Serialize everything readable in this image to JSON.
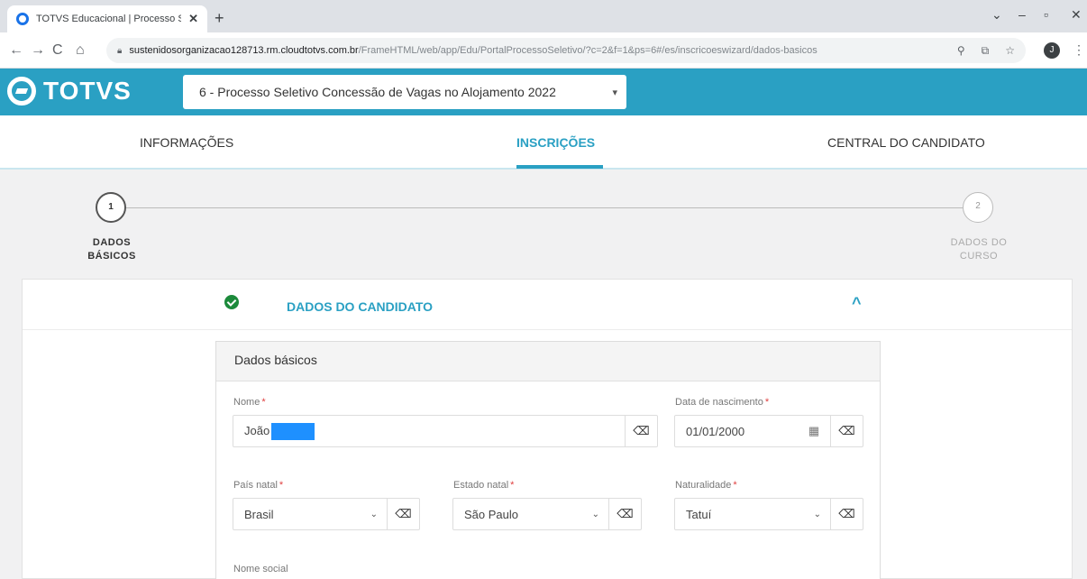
{
  "browser": {
    "tab_title": "TOTVS Educacional | Processo Se",
    "url_host": "sustenidosorganizacao128713.rm.cloudtotvs.com.br",
    "url_path": "/FrameHTML/web/app/Edu/PortalProcessoSeletivo/?c=2&f=1&ps=6#/es/inscricoeswizard/dados-basicos",
    "profile_initial": "J"
  },
  "header": {
    "logo_text": "TOTVS",
    "process_selected": "6 - Processo Seletivo Concessão de Vagas no Alojamento 2022"
  },
  "nav": {
    "items": [
      "INFORMAÇÕES",
      "INSCRIÇÕES",
      "CENTRAL DO CANDIDATO"
    ],
    "active": "INSCRIÇÕES"
  },
  "wizard": {
    "step1_number": "1",
    "step1_label": "DADOS BÁSICOS",
    "step2_number": "2",
    "step2_label": "DADOS DO CURSO"
  },
  "section": {
    "title": "DADOS DO CANDIDATO",
    "panel_title": "Dados básicos"
  },
  "form": {
    "nome_label": "Nome",
    "nome_value": "João",
    "nascimento_label": "Data de nascimento",
    "nascimento_value": "01/01/2000",
    "pais_label": "País natal",
    "pais_value": "Brasil",
    "estado_label": "Estado natal",
    "estado_value": "São Paulo",
    "naturalidade_label": "Naturalidade",
    "naturalidade_value": "Tatuí",
    "nome_social_label": "Nome social",
    "required_mark": "*"
  },
  "colors": {
    "brand": "#2aa0c3",
    "success": "#1c8a3b"
  },
  "icons": [
    "reload-icon",
    "back-icon",
    "forward-icon",
    "home-icon",
    "lock-icon",
    "zoom-icon",
    "share-icon",
    "star-icon",
    "calendar-icon",
    "eraser-icon",
    "chevron-up-icon",
    "check-circle-icon"
  ]
}
